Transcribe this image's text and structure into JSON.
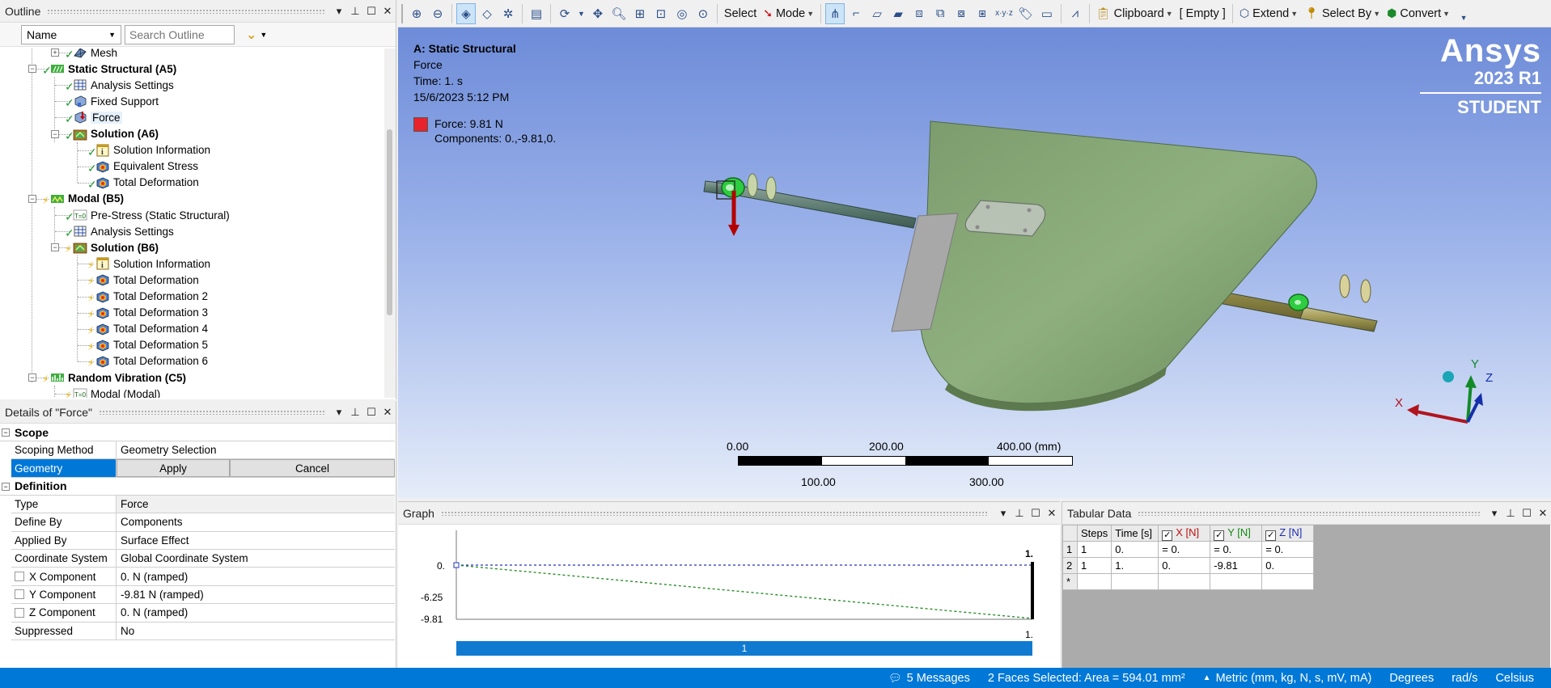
{
  "outline": {
    "title": "Outline",
    "filter_label": "Name",
    "search_placeholder": "Search Outline",
    "items": [
      {
        "label": "Mesh"
      },
      {
        "label": "Static Structural (A5)"
      },
      {
        "label": "Analysis Settings"
      },
      {
        "label": "Fixed Support"
      },
      {
        "label": "Force"
      },
      {
        "label": "Solution (A6)"
      },
      {
        "label": "Solution Information"
      },
      {
        "label": "Equivalent Stress"
      },
      {
        "label": "Total Deformation"
      },
      {
        "label": "Modal (B5)"
      },
      {
        "label": "Pre-Stress (Static Structural)"
      },
      {
        "label": "Analysis Settings"
      },
      {
        "label": "Solution (B6)"
      },
      {
        "label": "Solution Information"
      },
      {
        "label": "Total Deformation"
      },
      {
        "label": "Total Deformation 2"
      },
      {
        "label": "Total Deformation 3"
      },
      {
        "label": "Total Deformation 4"
      },
      {
        "label": "Total Deformation 5"
      },
      {
        "label": "Total Deformation 6"
      },
      {
        "label": "Random Vibration (C5)"
      },
      {
        "label": "Modal (Modal)"
      }
    ]
  },
  "details": {
    "title": "Details of \"Force\"",
    "scope_section": "Scope",
    "definition_section": "Definition",
    "scoping_method": {
      "key": "Scoping Method",
      "value": "Geometry Selection"
    },
    "geometry": {
      "key": "Geometry",
      "apply": "Apply",
      "cancel": "Cancel"
    },
    "type": {
      "key": "Type",
      "value": "Force"
    },
    "define_by": {
      "key": "Define By",
      "value": "Components"
    },
    "applied_by": {
      "key": "Applied By",
      "value": "Surface Effect"
    },
    "coord_system": {
      "key": "Coordinate System",
      "value": "Global Coordinate System"
    },
    "x_comp": {
      "key": "X Component",
      "value": "0. N  (ramped)"
    },
    "y_comp": {
      "key": "Y Component",
      "value": "-9.81 N  (ramped)"
    },
    "z_comp": {
      "key": "Z Component",
      "value": "0. N  (ramped)"
    },
    "suppressed": {
      "key": "Suppressed",
      "value": "No"
    }
  },
  "toolbar": {
    "select": "Select",
    "mode": "Mode",
    "clipboard": "Clipboard",
    "empty": "[ Empty ]",
    "extend": "Extend",
    "select_by": "Select By",
    "convert": "Convert"
  },
  "viewport": {
    "title": "A: Static Structural",
    "subtitle": "Force",
    "time": "Time: 1. s",
    "date": "15/6/2023 5:12 PM",
    "legend_line1": "Force: 9.81 N",
    "legend_line2": "Components: 0.,-9.81,0.",
    "legend_color": "#e8232b",
    "brand": {
      "name": "Ansys",
      "version": "2023 R1",
      "edition": "STUDENT"
    },
    "scale": {
      "t0": "0.00",
      "t200": "200.00",
      "t400": "400.00 (mm)",
      "t100": "100.00",
      "t300": "300.00"
    },
    "triad": {
      "x": "X",
      "y": "Y",
      "z": "Z"
    }
  },
  "graph": {
    "title": "Graph",
    "y_top": "0.",
    "y_mid": "-6.25",
    "y_bot": "-9.81",
    "x_top": "1.",
    "x_bot": "1.",
    "step": "1"
  },
  "tabular": {
    "title": "Tabular Data",
    "headers": {
      "steps": "Steps",
      "time": "Time [s]",
      "x": "X [N]",
      "y": "Y [N]",
      "z": "Z [N]"
    },
    "rows": [
      {
        "rn": "1",
        "steps": "1",
        "time": "0.",
        "x": "= 0.",
        "y": "= 0.",
        "z": "= 0."
      },
      {
        "rn": "2",
        "steps": "1",
        "time": "1.",
        "x": "0.",
        "y": "-9.81",
        "z": "0."
      },
      {
        "rn": "*",
        "steps": "",
        "time": "",
        "x": "",
        "y": "",
        "z": ""
      }
    ]
  },
  "status": {
    "messages": "5 Messages",
    "selection": "2 Faces Selected: Area = 594.01 mm²",
    "units": "Metric (mm, kg, N, s, mV, mA)",
    "angle": "Degrees",
    "rate": "rad/s",
    "temp": "Celsius"
  }
}
